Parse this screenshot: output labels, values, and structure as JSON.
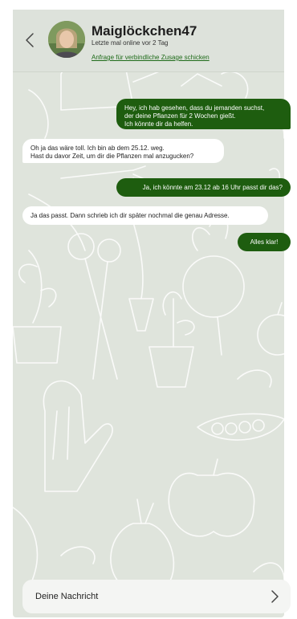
{
  "header": {
    "name": "Maiglöckchen47",
    "status": "Letzte mal online vor 2 Tag",
    "request_link": "Anfrage für verbindliche Zusage schicken"
  },
  "messages": [
    {
      "direction": "outgoing",
      "lines": [
        "Hey, ich hab gesehen, dass du jemanden suchst,",
        "der deine Pflanzen für 2 Wochen gießt.",
        "Ich könnte dir da helfen."
      ]
    },
    {
      "direction": "incoming",
      "lines": [
        "Oh ja das wäre toll. Ich bin ab dem 25.12. weg.",
        "Hast du davor Zeit, um dir die Pflanzen mal anzugucken?"
      ]
    },
    {
      "direction": "outgoing",
      "text": "Ja, ich könnte am 23.12 ab 16 Uhr passt dir das?"
    },
    {
      "direction": "incoming",
      "text": "Ja das passt. Dann schrieb ich dir später nochmal die genau Adresse."
    },
    {
      "direction": "outgoing",
      "text": "Alles klar!"
    }
  ],
  "composer": {
    "placeholder": "Deine Nachricht"
  },
  "icons": {
    "back": "chevron-left-icon",
    "send": "chevron-right-icon"
  },
  "colors": {
    "outgoing_bubble": "#1e5d0f",
    "incoming_bubble": "#ffffff",
    "background": "#dfe4dc",
    "link": "#1f6b1a"
  }
}
